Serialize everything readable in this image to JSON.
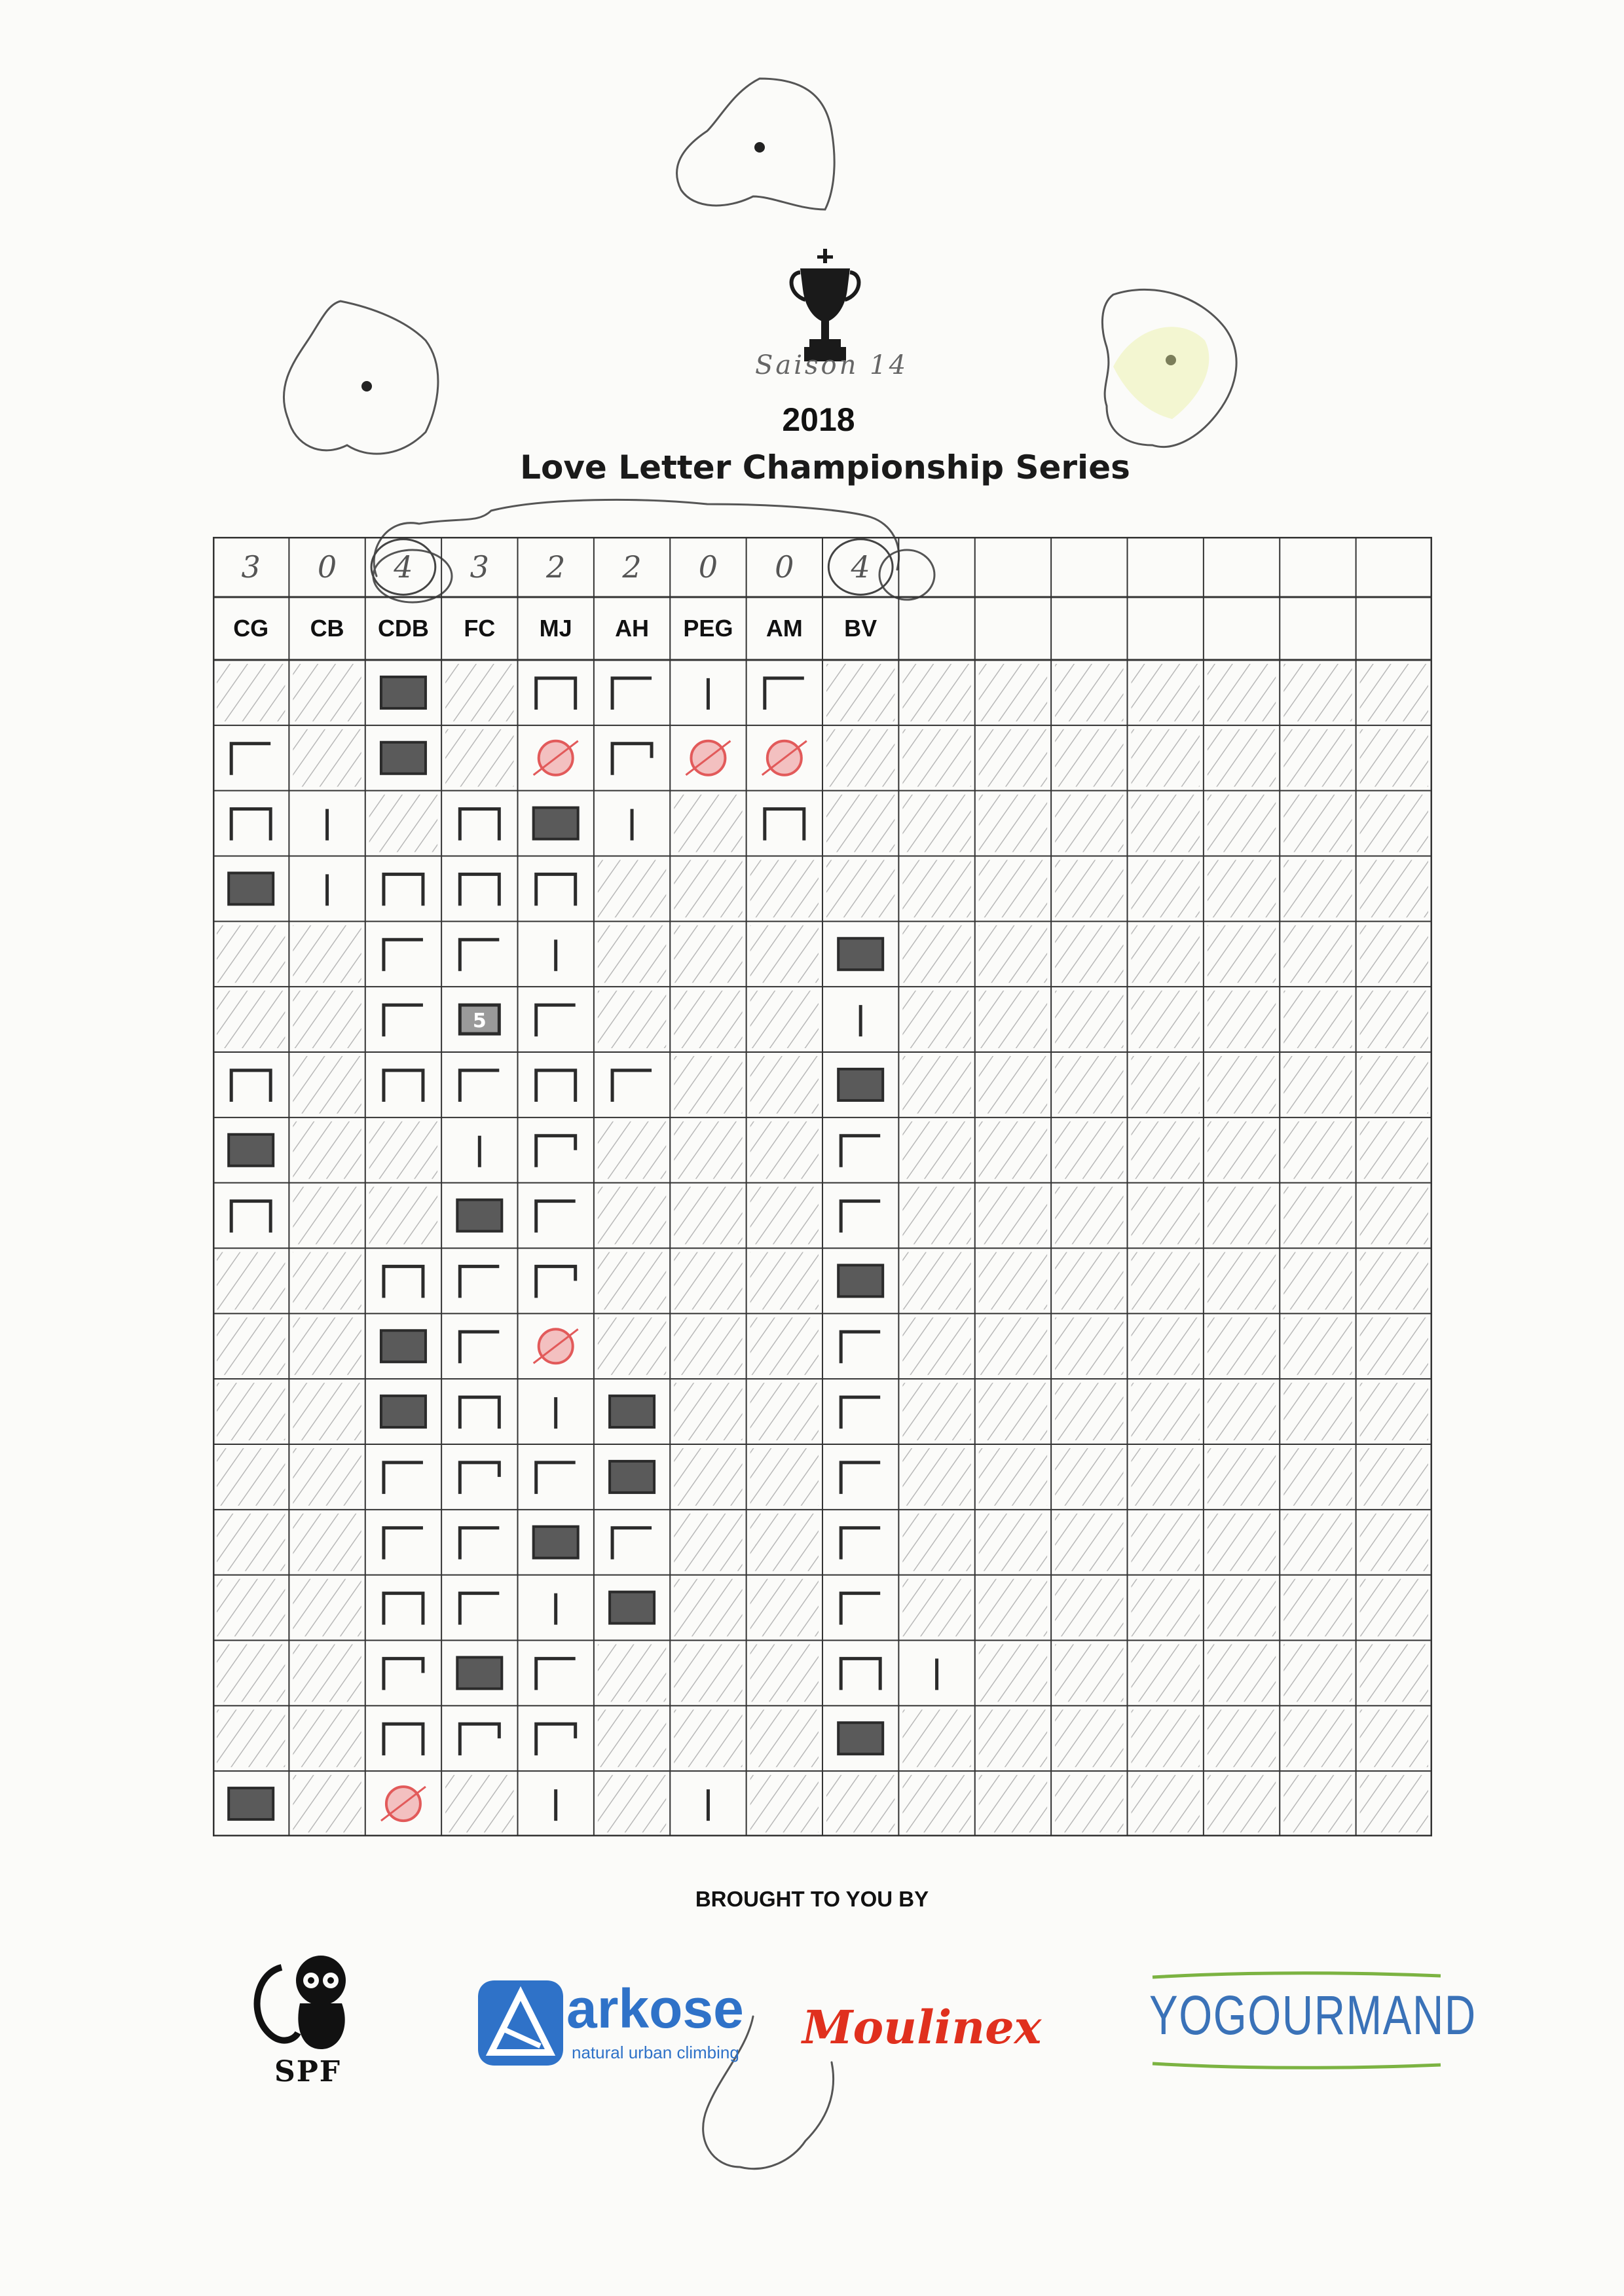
{
  "header": {
    "season_label": "Saison 14",
    "year": "2018",
    "title": "Love Letter Championship Series"
  },
  "icons": {
    "trophy": "trophy-icon",
    "hearts": "heart-doodle-icon"
  },
  "scoreboard": {
    "players": [
      "CG",
      "CB",
      "CDB",
      "FC",
      "MJ",
      "AH",
      "PEG",
      "AM",
      "BV",
      "",
      "",
      "",
      "",
      "",
      "",
      ""
    ],
    "scores": [
      "3",
      "0",
      "4",
      "3",
      "2",
      "2",
      "0",
      "0",
      "4",
      "",
      "",
      "",
      "",
      "",
      "",
      ""
    ],
    "circled_scores": [
      2,
      8
    ],
    "round_count": 18,
    "marks_note": "tally strokes per player per round; x = hatched cell",
    "marks": [
      [
        "x",
        "x",
        "S",
        "x",
        "4",
        "2",
        "1",
        "2",
        "x",
        "x",
        "x",
        "x",
        "x",
        "x",
        "x",
        "x"
      ],
      [
        "2",
        "x",
        "S",
        "x",
        "R",
        "3",
        "R",
        "R",
        "x",
        "x",
        "x",
        "x",
        "x",
        "x",
        "x",
        "x"
      ],
      [
        "4",
        "1",
        "x",
        "4",
        "S",
        "1",
        "x",
        "4",
        "x",
        "x",
        "x",
        "x",
        "x",
        "x",
        "x",
        "x"
      ],
      [
        "S",
        "1",
        "4",
        "4",
        "4",
        "x",
        "x",
        "x",
        "x",
        "x",
        "x",
        "x",
        "x",
        "x",
        "x",
        "x"
      ],
      [
        "x",
        "x",
        "2",
        "2",
        "1",
        "x",
        "x",
        "x",
        "S",
        "x",
        "x",
        "x",
        "x",
        "x",
        "x",
        "x"
      ],
      [
        "x",
        "x",
        "2",
        "5",
        "2",
        "x",
        "x",
        "x",
        "1",
        "x",
        "x",
        "x",
        "x",
        "x",
        "x",
        "x"
      ],
      [
        "4",
        "x",
        "4",
        "2",
        "4",
        "2",
        "x",
        "x",
        "S",
        "x",
        "x",
        "x",
        "x",
        "x",
        "x",
        "x"
      ],
      [
        "S",
        "x",
        "x",
        "1",
        "3",
        "x",
        "x",
        "x",
        "2",
        "x",
        "x",
        "x",
        "x",
        "x",
        "x",
        "x"
      ],
      [
        "4",
        "x",
        "x",
        "S",
        "2",
        "x",
        "x",
        "x",
        "2",
        "x",
        "x",
        "x",
        "x",
        "x",
        "x",
        "x"
      ],
      [
        "x",
        "x",
        "4",
        "2",
        "3",
        "x",
        "x",
        "x",
        "S",
        "x",
        "x",
        "x",
        "x",
        "x",
        "x",
        "x"
      ],
      [
        "x",
        "x",
        "S",
        "2",
        "R",
        "x",
        "x",
        "x",
        "2",
        "x",
        "x",
        "x",
        "x",
        "x",
        "x",
        "x"
      ],
      [
        "x",
        "x",
        "S",
        "4",
        "1",
        "S",
        "x",
        "x",
        "2",
        "x",
        "x",
        "x",
        "x",
        "x",
        "x",
        "x"
      ],
      [
        "x",
        "x",
        "2",
        "3",
        "2",
        "S",
        "x",
        "x",
        "2",
        "x",
        "x",
        "x",
        "x",
        "x",
        "x",
        "x"
      ],
      [
        "x",
        "x",
        "2",
        "2",
        "S",
        "2",
        "x",
        "x",
        "2",
        "x",
        "x",
        "x",
        "x",
        "x",
        "x",
        "x"
      ],
      [
        "x",
        "x",
        "4",
        "2",
        "1",
        "S",
        "x",
        "x",
        "2",
        "x",
        "x",
        "x",
        "x",
        "x",
        "x",
        "x"
      ],
      [
        "x",
        "x",
        "3",
        "S",
        "2",
        "x",
        "x",
        "x",
        "4",
        "1",
        "x",
        "x",
        "x",
        "x",
        "x",
        "x"
      ],
      [
        "x",
        "x",
        "4",
        "3",
        "3",
        "x",
        "x",
        "x",
        "S",
        "x",
        "x",
        "x",
        "x",
        "x",
        "x",
        "x"
      ],
      [
        "S",
        "x",
        "R",
        "x",
        "1",
        "x",
        "1",
        "x",
        "x",
        "x",
        "x",
        "x",
        "x",
        "x",
        "x",
        "x"
      ]
    ]
  },
  "colors": {
    "ink": "#2b2b2b",
    "pencil": "#9a9a9a",
    "red_circle": "#e25a5a",
    "arkose_blue": "#2f72c8",
    "moulinex_red": "#e0301e",
    "yogourmand_blue": "#3a72b8",
    "yogourmand_green": "#7cb342"
  },
  "footer": {
    "brought": "BROUGHT TO YOU BY",
    "sponsors": {
      "spf": "SPF",
      "arkose": "arkose",
      "arkose_tagline": "natural urban climbing",
      "moulinex": "Moulinex",
      "yogourmand": "YOGOURMAND"
    }
  }
}
